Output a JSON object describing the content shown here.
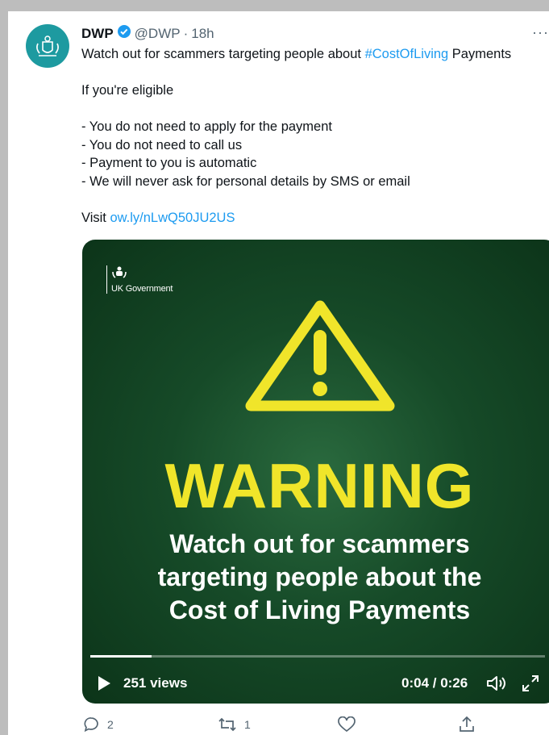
{
  "tweet": {
    "display_name": "DWP",
    "handle": "@DWP",
    "separator": "·",
    "time": "18h",
    "more": "···",
    "text_line1_pre": "Watch out for scammers targeting people about ",
    "text_line1_hashtag": "#CostOfLiving",
    "text_line1_post": " Payments",
    "eligible": "If you're eligible",
    "bullets": [
      "- You do not need to apply for the payment",
      "- You do not need to call us",
      "- Payment to you is automatic",
      "- We will never ask for personal details by SMS or email"
    ],
    "visit_label": "Visit ",
    "visit_link": "ow.ly/nLwQ50JU2US"
  },
  "media": {
    "gov_label": "UK Government",
    "warning": "WARNING",
    "headline": [
      "Watch out for scammers",
      "targeting people about the",
      "Cost of Living Payments"
    ],
    "views": "251 views",
    "time_display": "0:04 / 0:26",
    "progress": 0.135,
    "accent": "#f0e52a"
  },
  "actions": {
    "replies": "2",
    "retweets": "1",
    "likes": "",
    "share": ""
  },
  "colors": {
    "link": "#1d9bf0",
    "avatar_bg": "#1d9aa0",
    "verified": "#1d9bf0"
  }
}
